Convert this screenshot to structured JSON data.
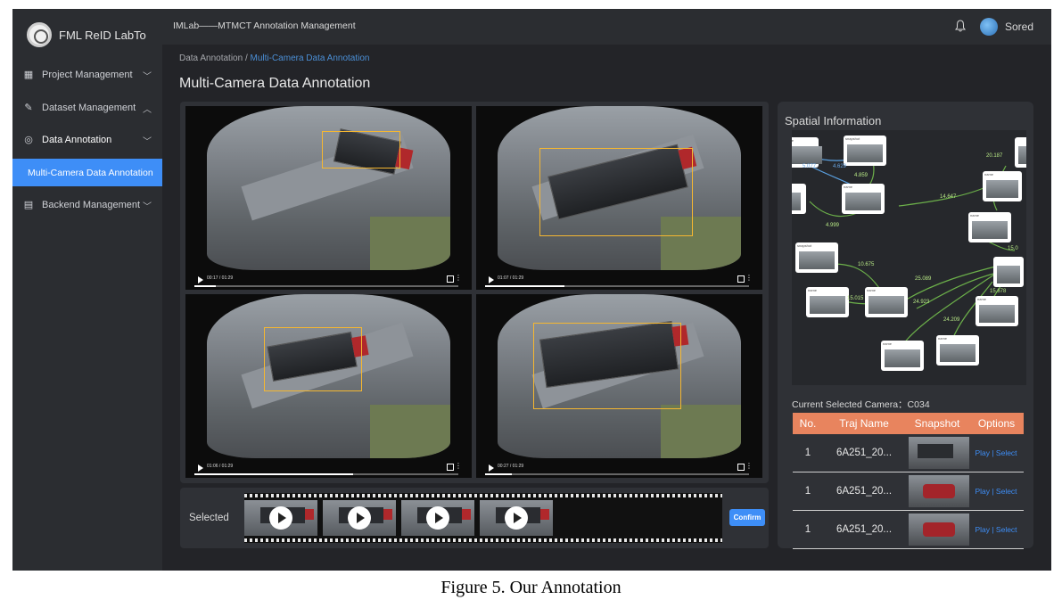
{
  "brand": {
    "name": "FML ReID LabTo"
  },
  "header": {
    "title": "IMLab——MTMCT Annotation Management",
    "user": "Sored"
  },
  "sidebar": {
    "items": [
      {
        "label": "Project Management",
        "icon": "grid-icon",
        "chevron": "down"
      },
      {
        "label": "Dataset Management",
        "icon": "edit-icon",
        "chevron": "up"
      },
      {
        "label": "Data Annotation",
        "icon": "check-circle-icon",
        "chevron": "down"
      },
      {
        "label": "Multi-Camera Data Annotation"
      },
      {
        "label": "Backend Management",
        "icon": "document-icon",
        "chevron": "down"
      }
    ]
  },
  "breadcrumb": {
    "parent": "Data Annotation /",
    "current": "Multi-Camera Data Annotation"
  },
  "page": {
    "title": "Multi-Camera Data Annotation"
  },
  "videos": [
    {
      "time": "00:17 / 01:29",
      "progress": 0.08
    },
    {
      "time": "01:07 / 01:29",
      "progress": 0.3
    },
    {
      "time": "01:06 / 01:29",
      "progress": 0.6
    },
    {
      "time": "00:27 / 01:29",
      "progress": 0.1
    }
  ],
  "selected": {
    "label": "Selected",
    "confirm": "Confirm"
  },
  "spatial": {
    "title": "Spatial Information",
    "node_label": "name",
    "node_sub": "snapshot",
    "edges": [
      {
        "label": "5.077",
        "blue": true
      },
      {
        "label": "4.629",
        "blue": true
      },
      {
        "label": "4.859",
        "blue": false
      },
      {
        "label": "4.999",
        "blue": false
      },
      {
        "label": "20.187",
        "blue": false
      },
      {
        "label": "14.647",
        "blue": false
      },
      {
        "label": "10.675",
        "blue": false
      },
      {
        "label": "15.0",
        "blue": false
      },
      {
        "label": "25.089",
        "blue": false
      },
      {
        "label": "15.678",
        "blue": false
      },
      {
        "label": "15.015",
        "blue": false
      },
      {
        "label": "24.923",
        "blue": false
      },
      {
        "label": "24.209",
        "blue": false
      }
    ],
    "current_camera": "Current Selected Camera：C034",
    "table": {
      "headers": [
        "No.",
        "Traj Name",
        "Snapshot",
        "Options"
      ],
      "rows": [
        {
          "no": "1",
          "name": "6A251_20...",
          "options": "Play | Select",
          "snapshot": "truck"
        },
        {
          "no": "1",
          "name": "6A251_20...",
          "options": "Play | Select",
          "snapshot": "car"
        },
        {
          "no": "1",
          "name": "6A251_20...",
          "options": "Play | Select",
          "snapshot": "car"
        }
      ]
    }
  },
  "caption": "Figure 5. Our Annotation"
}
